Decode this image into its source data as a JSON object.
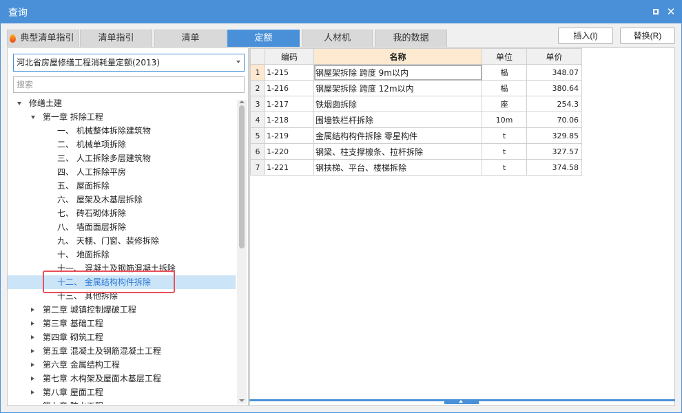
{
  "window": {
    "title": "查询",
    "maximize_icon": "maximize-icon",
    "close_icon": "close-icon",
    "close_glyph": "✕"
  },
  "tabs": [
    {
      "label": "典型清单指引",
      "icon": "fire-icon",
      "active": false
    },
    {
      "label": "清单指引",
      "active": false
    },
    {
      "label": "清单",
      "active": false
    },
    {
      "label": "定额",
      "active": true
    },
    {
      "label": "人材机",
      "active": false
    },
    {
      "label": "我的数据",
      "active": false
    }
  ],
  "toolbar": {
    "insert_label": "插入(I)",
    "replace_label": "替换(R)"
  },
  "left": {
    "quota_library": "河北省房屋修缮工程消耗量定额(2013)",
    "search_placeholder": "搜索",
    "tree": [
      {
        "label": "修缮土建",
        "level": 0,
        "expander": "open"
      },
      {
        "label": "第一章 拆除工程",
        "level": 1,
        "expander": "open"
      },
      {
        "label": "一、 机械整体拆除建筑物",
        "level": 2,
        "expander": "none"
      },
      {
        "label": "二、 机械单项拆除",
        "level": 2,
        "expander": "none"
      },
      {
        "label": "三、 人工拆除多层建筑物",
        "level": 2,
        "expander": "none"
      },
      {
        "label": "四、 人工拆除平房",
        "level": 2,
        "expander": "none"
      },
      {
        "label": "五、 屋面拆除",
        "level": 2,
        "expander": "none"
      },
      {
        "label": "六、 屋架及木基层拆除",
        "level": 2,
        "expander": "none"
      },
      {
        "label": "七、 砖石砌体拆除",
        "level": 2,
        "expander": "none"
      },
      {
        "label": "八、 墙面面层拆除",
        "level": 2,
        "expander": "none"
      },
      {
        "label": "九、 天棚、门窗、装修拆除",
        "level": 2,
        "expander": "none"
      },
      {
        "label": "十、 地面拆除",
        "level": 2,
        "expander": "none"
      },
      {
        "label": "十一、 混凝土及钢筋混凝土拆除",
        "level": 2,
        "expander": "none"
      },
      {
        "label": "十二、 金属结构构件拆除",
        "level": 2,
        "expander": "none",
        "selected": true
      },
      {
        "label": "十三、 其他拆除",
        "level": 2,
        "expander": "none"
      },
      {
        "label": "第二章 城镇控制爆破工程",
        "level": 1,
        "expander": "closed"
      },
      {
        "label": "第三章 基础工程",
        "level": 1,
        "expander": "closed"
      },
      {
        "label": "第四章 砌筑工程",
        "level": 1,
        "expander": "closed"
      },
      {
        "label": "第五章 混凝土及钢筋混凝土工程",
        "level": 1,
        "expander": "closed"
      },
      {
        "label": "第六章 金属结构工程",
        "level": 1,
        "expander": "closed"
      },
      {
        "label": "第七章 木构架及屋面木基层工程",
        "level": 1,
        "expander": "closed"
      },
      {
        "label": "第八章 屋面工程",
        "level": 1,
        "expander": "closed"
      },
      {
        "label": "第九章 防水工程",
        "level": 1,
        "expander": "closed"
      }
    ]
  },
  "grid": {
    "columns": [
      "",
      "编码",
      "名称",
      "单位",
      "单价"
    ],
    "sorted_column": 2,
    "rows": [
      {
        "num": "1",
        "code": "1-215",
        "name": "钢屋架拆除 跨度 9m以内",
        "unit": "榀",
        "price": "348.07"
      },
      {
        "num": "2",
        "code": "1-216",
        "name": "钢屋架拆除 跨度 12m以内",
        "unit": "榀",
        "price": "380.64"
      },
      {
        "num": "3",
        "code": "1-217",
        "name": "铁烟囱拆除",
        "unit": "座",
        "price": "254.3"
      },
      {
        "num": "4",
        "code": "1-218",
        "name": "围墙铁栏杆拆除",
        "unit": "10m",
        "price": "70.06"
      },
      {
        "num": "5",
        "code": "1-219",
        "name": "金属结构构件拆除 零星构件",
        "unit": "t",
        "price": "329.85"
      },
      {
        "num": "6",
        "code": "1-220",
        "name": "钢梁、柱支撑檩条、拉杆拆除",
        "unit": "t",
        "price": "327.57"
      },
      {
        "num": "7",
        "code": "1-221",
        "name": "钢扶梯、平台、楼梯拆除",
        "unit": "t",
        "price": "374.58"
      }
    ],
    "current_row": 0
  },
  "colors": {
    "accent": "#4a90d9",
    "highlight": "#e8505b",
    "selected_bg": "#cce4f7",
    "header_sorted_bg": "#fde9d0"
  }
}
